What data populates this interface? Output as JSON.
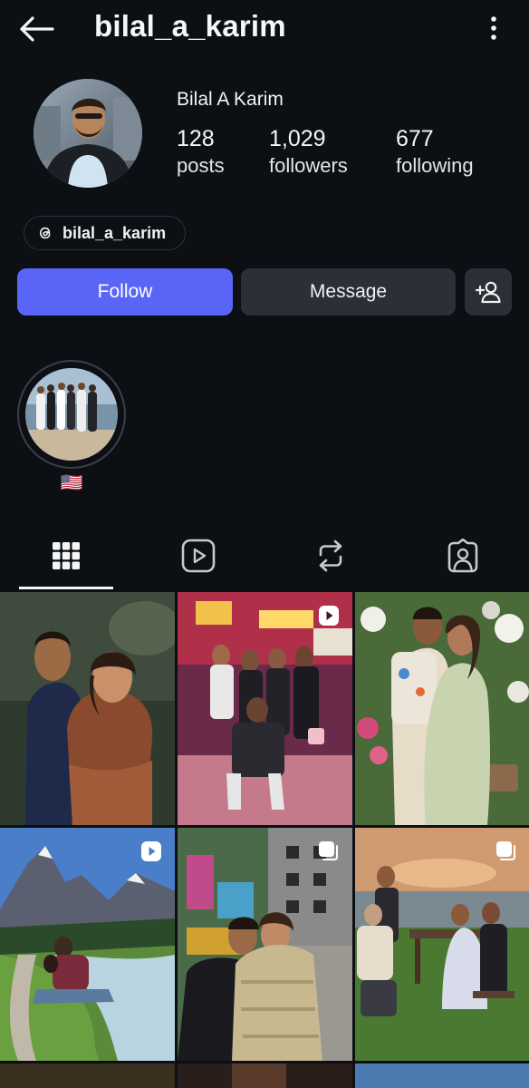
{
  "header": {
    "username": "bilal_a_karim",
    "back_icon": "arrow-left-icon",
    "more_icon": "vertical-dots-icon"
  },
  "profile": {
    "full_name": "Bilal A Karim",
    "stats": {
      "posts": {
        "value": "128",
        "label": "posts"
      },
      "followers": {
        "value": "1,029",
        "label": "followers"
      },
      "following": {
        "value": "677",
        "label": "following"
      }
    },
    "threads_handle": "bilal_a_karim"
  },
  "actions": {
    "follow_label": "Follow",
    "message_label": "Message",
    "add_user_icon": "add-person-icon"
  },
  "highlights": [
    {
      "label": "🇺🇸"
    }
  ],
  "tabs": [
    {
      "icon": "grid-icon",
      "active": true
    },
    {
      "icon": "reels-icon",
      "active": false
    },
    {
      "icon": "repost-icon",
      "active": false
    },
    {
      "icon": "tagged-icon",
      "active": false
    }
  ],
  "posts": [
    {
      "type": "photo"
    },
    {
      "type": "reel"
    },
    {
      "type": "photo"
    },
    {
      "type": "reel"
    },
    {
      "type": "carousel"
    },
    {
      "type": "carousel"
    }
  ],
  "colors": {
    "background": "#0c0f14",
    "follow_button": "#5865f7",
    "secondary_button": "#2b2f37"
  }
}
